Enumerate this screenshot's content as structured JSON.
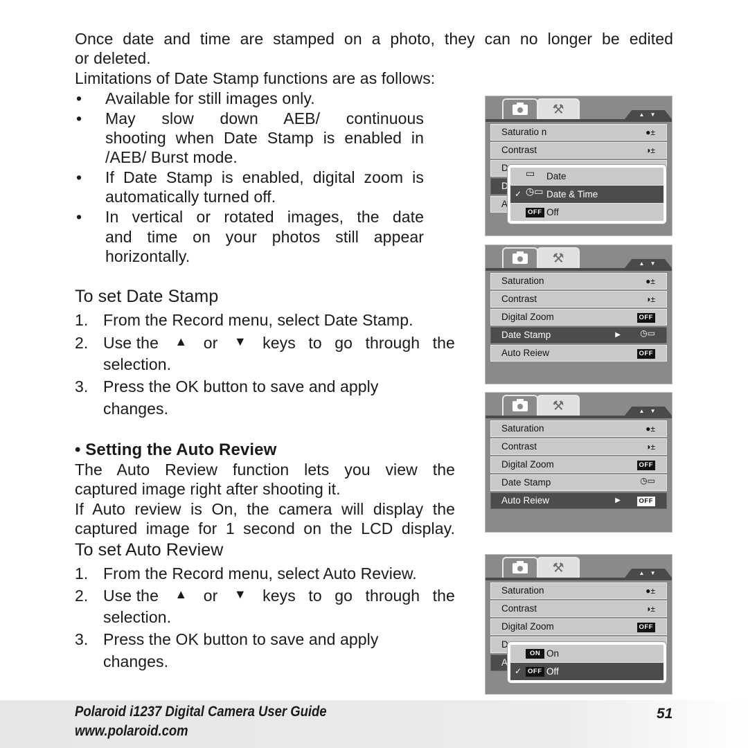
{
  "intro": {
    "line1": "Once date and time are stamped on a photo, they can no longer be edited",
    "line2": "or deleted.",
    "limitations_heading": "Limitations of Date Stamp functions are as follows:",
    "bullets": [
      {
        "lines": [
          "Available for still images only."
        ]
      },
      {
        "lines": [
          "May slow down AEB/ continuous",
          "shooting when Date Stamp is enabled in",
          "/AEB/ Burst mode."
        ]
      },
      {
        "lines": [
          "If Date Stamp is enabled, digital zoom is",
          "automatically turned off."
        ]
      },
      {
        "lines": [
          "In vertical or rotated images, the date",
          "and time on your photos still appear",
          "horizontally."
        ]
      }
    ],
    "bullet_char": "•"
  },
  "date_stamp_steps": {
    "heading": "To set Date Stamp",
    "steps": [
      {
        "num": "1.",
        "text": "From the Record menu, select Date Stamp."
      },
      {
        "num": "2.",
        "pre": "Use the",
        "up": "▲",
        "mid": "or",
        "down": "▼",
        "post": "keys to go through the",
        "cont": "selection."
      },
      {
        "num": "3.",
        "text": "Press the OK button to save and apply",
        "cont": "changes."
      }
    ]
  },
  "auto_review": {
    "section_title": "• Setting the Auto Review",
    "desc1": [
      "The Auto Review function lets you view the",
      "captured image right after shooting it."
    ],
    "desc2": [
      "If Auto review is On, the camera will display the",
      "captured image for 1 second on the LCD display."
    ],
    "heading": "To set Auto Review",
    "steps": [
      {
        "num": "1.",
        "text": "From the Record menu, select Auto Review."
      },
      {
        "num": "2.",
        "pre": "Use the",
        "up": "▲",
        "mid": "or",
        "down": "▼",
        "post": "keys to go through the",
        "cont": "selection."
      },
      {
        "num": "3.",
        "text": "Press the OK button to save and apply",
        "cont": "changes."
      }
    ]
  },
  "screens": {
    "nav_arrows": "▲ ▼",
    "wrench_glyph": "⚒",
    "screen1": {
      "rows": [
        "Saturatio n",
        "Contrast",
        "D",
        "D",
        "A"
      ],
      "row_values": [
        "●±",
        "◑±"
      ],
      "popup": [
        {
          "check": "",
          "icon": "▭",
          "label": "Date"
        },
        {
          "check": "✓",
          "icon": "◷▭",
          "label": "Date & Time"
        },
        {
          "check": "",
          "icon": "OFF",
          "label": "Off"
        }
      ]
    },
    "screen2": {
      "rows": [
        {
          "label": "Saturation",
          "value": "●±"
        },
        {
          "label": "Contrast",
          "value": "◑±"
        },
        {
          "label": "Digital Zoom",
          "value": "OFF"
        },
        {
          "label": "Date Stamp",
          "value": "◷▭",
          "caret": "▶"
        },
        {
          "label": "Auto Reiew",
          "value": "OFF"
        }
      ]
    },
    "screen3": {
      "rows": [
        {
          "label": "Saturation",
          "value": "●±"
        },
        {
          "label": "Contrast",
          "value": "◑±"
        },
        {
          "label": "Digital Zoom",
          "value": "OFF"
        },
        {
          "label": "Date Stamp",
          "value": "◷▭"
        },
        {
          "label": "Auto Reiew",
          "value": "OFF",
          "caret": "▶"
        }
      ]
    },
    "screen4": {
      "rows": [
        "Saturation",
        "Contrast",
        "Digital Zoom",
        "D",
        "A"
      ],
      "row_values": [
        "●±",
        "◑±",
        "OFF"
      ],
      "popup": [
        {
          "check": "",
          "icon": "ON",
          "label": "On"
        },
        {
          "check": "✓",
          "icon": "OFF",
          "label": "Off"
        }
      ]
    }
  },
  "footer": {
    "title": "Polaroid i1237 Digital Camera User Guide",
    "url": "www.polaroid.com",
    "page": "51"
  }
}
